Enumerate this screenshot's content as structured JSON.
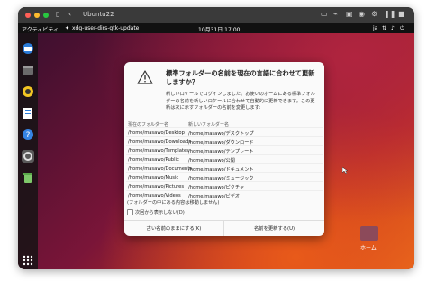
{
  "vm": {
    "title": "Ubuntu22"
  },
  "topbar": {
    "activities": "アクティビティ",
    "app_name": "xdg-user-dirs-gtk-update",
    "clock": "10月31日  17:00",
    "input_method": "ja"
  },
  "desktop": {
    "home_label": "ホーム"
  },
  "dialog": {
    "title": "標準フォルダーの名前を現在の言語に合わせて更新しますか？",
    "body": "新しいロケールでログインしました。お使いのホームにある標準フォルダーの名前を新しいロケールに合わせて自動的に更新できます。この更新は次に示すフォルダーの名前を変更します:",
    "columns": {
      "current": "現在のフォルダー名",
      "new": "新しいフォルダー名"
    },
    "rows": [
      {
        "current": "/home/masawo/Desktop",
        "new": "/home/masawo/デスクトップ"
      },
      {
        "current": "/home/masawo/Downloads",
        "new": "/home/masawo/ダウンロード"
      },
      {
        "current": "/home/masawo/Templates",
        "new": "/home/masawo/テンプレート"
      },
      {
        "current": "/home/masawo/Public",
        "new": "/home/masawo/公開"
      },
      {
        "current": "/home/masawo/Documents",
        "new": "/home/masawo/ドキュメント"
      },
      {
        "current": "/home/masawo/Music",
        "new": "/home/masawo/ミュージック"
      },
      {
        "current": "/home/masawo/Pictures",
        "new": "/home/masawo/ピクチャ"
      },
      {
        "current": "/home/masawo/Videos",
        "new": "/home/masawo/ビデオ"
      }
    ],
    "note": "(フォルダーの中にある内容は移動しません)",
    "dont_ask": "次回から表示しない(D)",
    "keep_button": "古い名前のままにする(K)",
    "update_button": "名前を更新する(U)"
  }
}
